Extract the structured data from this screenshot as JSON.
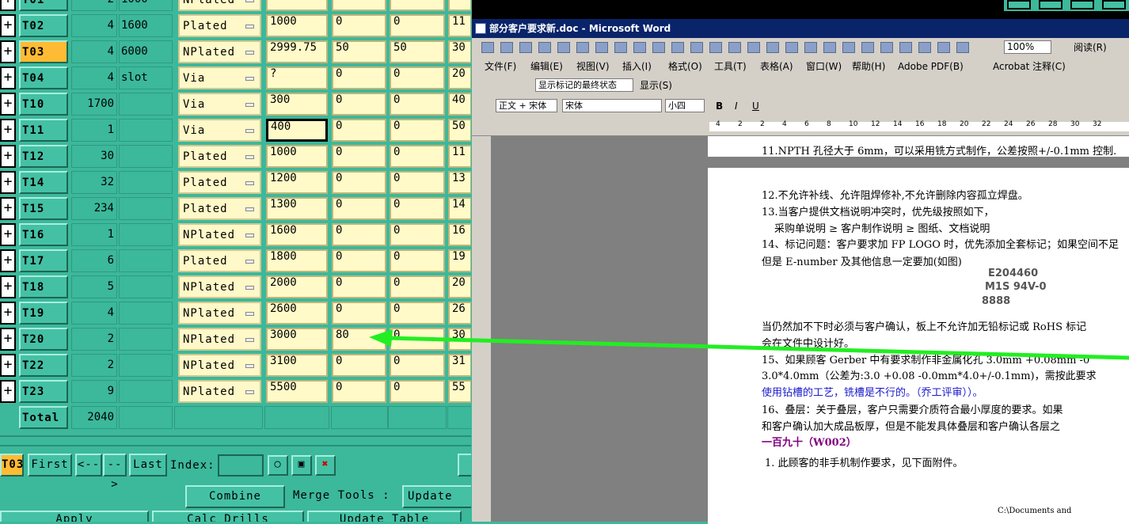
{
  "tools": [
    {
      "id": "T01",
      "count": "2",
      "size": "1000",
      "type": "NPlated",
      "v1": "",
      "v2": "",
      "v3": "",
      "v4": ""
    },
    {
      "id": "T02",
      "count": "4",
      "size": "1600",
      "type": "Plated",
      "v1": "1000",
      "v2": "0",
      "v3": "0",
      "v4": "11"
    },
    {
      "id": "T03",
      "count": "4",
      "size": "6000",
      "type": "NPlated",
      "v1": "2999.75",
      "v2": "50",
      "v3": "50",
      "v4": "30"
    },
    {
      "id": "T04",
      "count": "4",
      "size": "slot",
      "type": "Via",
      "v1": "?",
      "v2": "0",
      "v3": "0",
      "v4": "20"
    },
    {
      "id": "T10",
      "count": "1700",
      "size": "",
      "type": "Via",
      "v1": "300",
      "v2": "0",
      "v3": "0",
      "v4": "40"
    },
    {
      "id": "T11",
      "count": "1",
      "size": "",
      "type": "Via",
      "v1": "400",
      "v2": "0",
      "v3": "0",
      "v4": "50"
    },
    {
      "id": "T12",
      "count": "30",
      "size": "",
      "type": "Plated",
      "v1": "1000",
      "v2": "0",
      "v3": "0",
      "v4": "11"
    },
    {
      "id": "T14",
      "count": "32",
      "size": "",
      "type": "Plated",
      "v1": "1200",
      "v2": "0",
      "v3": "0",
      "v4": "13"
    },
    {
      "id": "T15",
      "count": "234",
      "size": "",
      "type": "Plated",
      "v1": "1300",
      "v2": "0",
      "v3": "0",
      "v4": "14"
    },
    {
      "id": "T16",
      "count": "1",
      "size": "",
      "type": "NPlated",
      "v1": "1600",
      "v2": "0",
      "v3": "0",
      "v4": "16"
    },
    {
      "id": "T17",
      "count": "6",
      "size": "",
      "type": "Plated",
      "v1": "1800",
      "v2": "0",
      "v3": "0",
      "v4": "19"
    },
    {
      "id": "T18",
      "count": "5",
      "size": "",
      "type": "NPlated",
      "v1": "2000",
      "v2": "0",
      "v3": "0",
      "v4": "20"
    },
    {
      "id": "T19",
      "count": "4",
      "size": "",
      "type": "NPlated",
      "v1": "2600",
      "v2": "0",
      "v3": "0",
      "v4": "26"
    },
    {
      "id": "T20",
      "count": "2",
      "size": "",
      "type": "NPlated",
      "v1": "3000",
      "v2": "80",
      "v3": "0",
      "v4": "30"
    },
    {
      "id": "T22",
      "count": "2",
      "size": "",
      "type": "NPlated",
      "v1": "3100",
      "v2": "0",
      "v3": "0",
      "v4": "31"
    },
    {
      "id": "T23",
      "count": "9",
      "size": "",
      "type": "NPlated",
      "v1": "5500",
      "v2": "0",
      "v3": "0",
      "v4": "55"
    }
  ],
  "total": {
    "label": "Total",
    "value": "2040"
  },
  "nav": {
    "current": "T03",
    "first": "First",
    "prev": "<--",
    "next": "-->",
    "last": "Last",
    "index_label": "Index:"
  },
  "actions": {
    "combine": "Combine Tools",
    "merge": "Merge Tools :",
    "update_tools": "Update To",
    "apply": "Apply",
    "calc": "Calc Drills",
    "update_table": "Update Table"
  },
  "word": {
    "title": "部分客户要求新.doc - Microsoft Word",
    "menu": [
      "文件(F)",
      "编辑(E)",
      "视图(V)",
      "插入(I)",
      "格式(O)",
      "工具(T)",
      "表格(A)",
      "窗口(W)",
      "帮助(H)",
      "Adobe PDF(B)",
      "Acrobat 注释(C)"
    ],
    "reading": "阅读(R)",
    "zoom": "100%",
    "track": "显示标记的最终状态",
    "show": "显示(S)",
    "style": "正文 + 宋体",
    "font": "宋体",
    "size": "小四",
    "lines": [
      "11.NPTH 孔径大于 6mm，可以采用铣方式制作，公差按照+/-0.1mm 控制.",
      "12.不允许补线、允许阻焊修补,不允许删除内容孤立焊盘。",
      "13.当客户提供文档说明冲突时，优先级按照如下，",
      "采购单说明 ≥ 客户制作说明 ≥ 图纸、文档说明",
      "14、标记问题：客户要求加 FP LOGO 时，优先添加全套标记；如果空间不足",
      "但是 E-number 及其他信息一定要加(如图)",
      "E204460",
      "M1S 94V-0",
      "8888",
      "当仍然加不下时必须与客户确认，板上不允许加无铅标记或 RoHS 标记",
      "会在文件中设计好。",
      "15、如果顾客 Gerber 中有要求制作非金属化孔 3.0mm +0.08mm -0",
      "3.0*4.0mm（公差为:3.0 +0.08 -0.0mm*4.0+/-0.1mm)，需按此要求",
      "使用钻槽的工艺，铣槽是不行的。（乔工评审））。",
      "16、叠层：关于叠层，客户只需要介质符合最小厚度的要求。如果",
      "和客户确认加大成品板厚，但是不能发具体叠层和客户确认各层之",
      "一百九十（W002）",
      "1. 此顾客的非手机制作要求，见下面附件。",
      "C:\\Documents and"
    ],
    "ruler": [
      "4",
      "2",
      "2",
      "4",
      "6",
      "8",
      "10",
      "12",
      "14",
      "16",
      "18",
      "20",
      "22",
      "24",
      "26",
      "28",
      "30",
      "32"
    ]
  },
  "colors": {
    "bg": "#3cb89b",
    "selected": "#ffbb33",
    "arrow": "#22ee22"
  }
}
